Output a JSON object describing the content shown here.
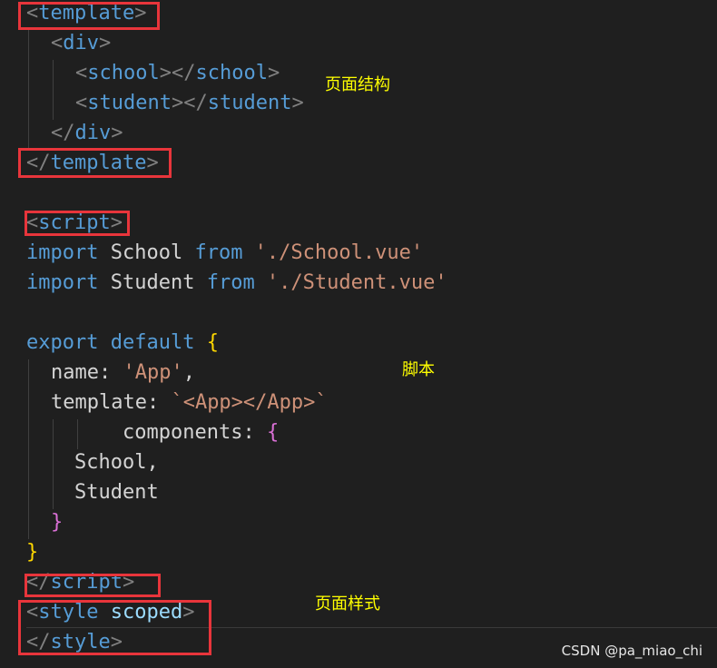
{
  "code": {
    "l1_open": "<",
    "l1_name": "template",
    "l1_close": ">",
    "l2_open": "<",
    "l2_name": "div",
    "l2_close": ">",
    "l3_a": "<",
    "l3_b": "school",
    "l3_c": "></",
    "l3_d": "school",
    "l3_e": ">",
    "l4_a": "<",
    "l4_b": "student",
    "l4_c": "></",
    "l4_d": "student",
    "l4_e": ">",
    "l5_a": "</",
    "l5_b": "div",
    "l5_c": ">",
    "l6_a": "</",
    "l6_b": "template",
    "l6_c": ">",
    "l8_a": "<",
    "l8_b": "script",
    "l8_c": ">",
    "l9_kw": "import",
    "l9_id": " School ",
    "l9_from": "from",
    "l9_str": " './School.vue'",
    "l10_kw": "import",
    "l10_id": " Student ",
    "l10_from": "from",
    "l10_str": " './Student.vue'",
    "l12_kw1": "export",
    "l12_kw2": " default ",
    "l12_br": "{",
    "l13_key": "name: ",
    "l13_str": "'App'",
    "l13_comma": ",",
    "l14_key": "template: ",
    "l14_str": "`<App></App>`",
    "l15_key": "components: ",
    "l15_br": "{",
    "l16": "School,",
    "l17": "Student",
    "l18_br": "}",
    "l19_br": "}",
    "l20_a": "</",
    "l20_b": "script",
    "l20_c": ">",
    "l21_a": "<",
    "l21_b": "style",
    "l21_attr": " scoped",
    "l21_c": ">",
    "l22_a": "</",
    "l22_b": "style",
    "l22_c": ">"
  },
  "notes": {
    "structure": "页面结构",
    "script": "脚本",
    "style": "页面样式"
  },
  "watermark": "CSDN @pa_miao_chi",
  "colors": {
    "highlight_box": "#e8353b",
    "note_text": "#ffff00",
    "background": "#1f1f1f"
  }
}
